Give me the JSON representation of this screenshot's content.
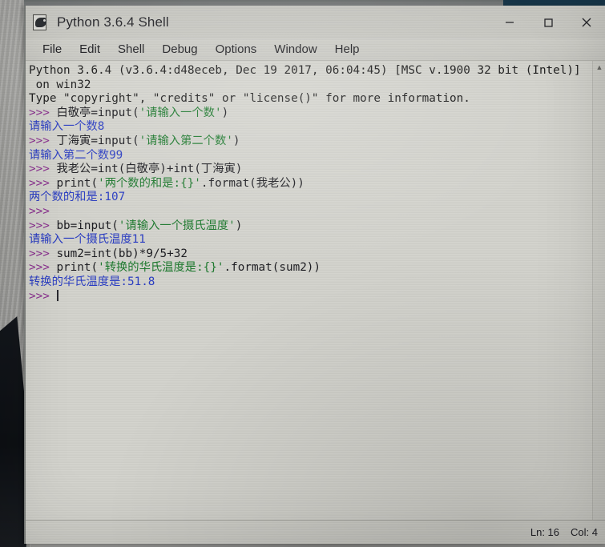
{
  "window": {
    "title": "Python 3.6.4 Shell",
    "icon": "python-idle-icon",
    "controls": {
      "minimize": "minimize-button",
      "maximize": "maximize-button",
      "close": "close-button"
    }
  },
  "menubar": {
    "items": [
      {
        "label": "File"
      },
      {
        "label": "Edit"
      },
      {
        "label": "Shell"
      },
      {
        "label": "Debug"
      },
      {
        "label": "Options"
      },
      {
        "label": "Window"
      },
      {
        "label": "Help"
      }
    ]
  },
  "shell": {
    "banner": [
      "Python 3.6.4 (v3.6.4:d48eceb, Dec 19 2017, 06:04:45) [MSC v.1900 32 bit (Intel)]",
      " on win32",
      "Type \"copyright\", \"credits\" or \"license()\" for more information."
    ],
    "lines": [
      {
        "type": "input",
        "prompt": ">>> ",
        "code_before": "白敬亭=input(",
        "string": "'请输入一个数'",
        "code_after": ")"
      },
      {
        "type": "output",
        "text": "请输入一个数8"
      },
      {
        "type": "input",
        "prompt": ">>> ",
        "code_before": "丁海寅=input(",
        "string": "'请输入第二个数'",
        "code_after": ")"
      },
      {
        "type": "output",
        "text": "请输入第二个数99"
      },
      {
        "type": "input",
        "prompt": ">>> ",
        "code_before": "我老公=int(白敬亭)+int(丁海寅)",
        "string": "",
        "code_after": ""
      },
      {
        "type": "input",
        "prompt": ">>> ",
        "code_before": "print(",
        "string": "'两个数的和是:{}'",
        "code_after": ".format(我老公))"
      },
      {
        "type": "output",
        "text": "两个数的和是:107"
      },
      {
        "type": "input",
        "prompt": ">>> ",
        "code_before": "",
        "string": "",
        "code_after": ""
      },
      {
        "type": "input",
        "prompt": ">>> ",
        "code_before": "bb=input(",
        "string": "'请输入一个摄氏温度'",
        "code_after": ")"
      },
      {
        "type": "output",
        "text": "请输入一个摄氏温度11"
      },
      {
        "type": "input",
        "prompt": ">>> ",
        "code_before": "sum2=int(bb)*9/5+32",
        "string": "",
        "code_after": ""
      },
      {
        "type": "input",
        "prompt": ">>> ",
        "code_before": "print(",
        "string": "'转换的华氏温度是:{}'",
        "code_after": ".format(sum2))"
      },
      {
        "type": "output",
        "text": "转换的华氏温度是:51.8"
      },
      {
        "type": "caret",
        "prompt": ">>> ",
        "code_before": "",
        "string": "",
        "code_after": ""
      }
    ]
  },
  "statusbar": {
    "line_label": "Ln: 16",
    "col_label": "Col: 4"
  },
  "colors": {
    "prompt": "#8a2f8f",
    "code": "#1d1d22",
    "string": "#1d7a2e",
    "output": "#2b3ec4",
    "window_bg": "#d4d4ce",
    "chrome": "#cfcfc9",
    "desktop": "#17384c"
  }
}
